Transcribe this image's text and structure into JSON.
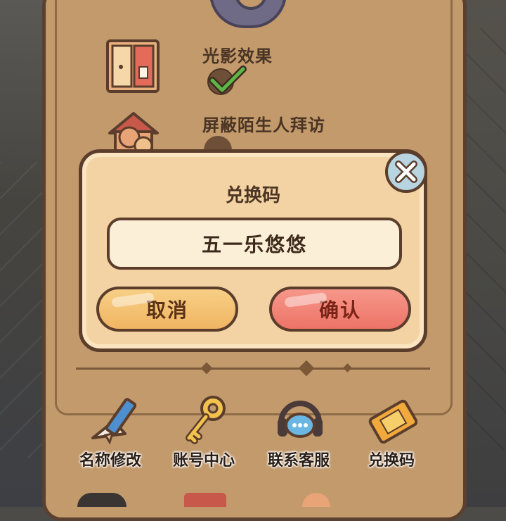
{
  "settings": {
    "lighting_label": "光影效果",
    "lighting_enabled": true,
    "block_visitors_label": "屏蔽陌生人拜访"
  },
  "dialog": {
    "title": "兑换码",
    "input_value": "五一乐悠悠",
    "cancel_label": "取消",
    "confirm_label": "确认",
    "close_icon": "close-icon"
  },
  "bottom_menu": {
    "items": [
      {
        "label": "名称修改",
        "icon": "pencil-icon"
      },
      {
        "label": "账号中心",
        "icon": "key-icon"
      },
      {
        "label": "联系客服",
        "icon": "headset-icon"
      },
      {
        "label": "兑换码",
        "icon": "ticket-icon"
      }
    ]
  },
  "colors": {
    "panel": "#c39a6c",
    "dialog": "#f3d3a3",
    "cancel": "#f0b563",
    "confirm": "#ec7467",
    "outline": "#5b3d2c"
  }
}
